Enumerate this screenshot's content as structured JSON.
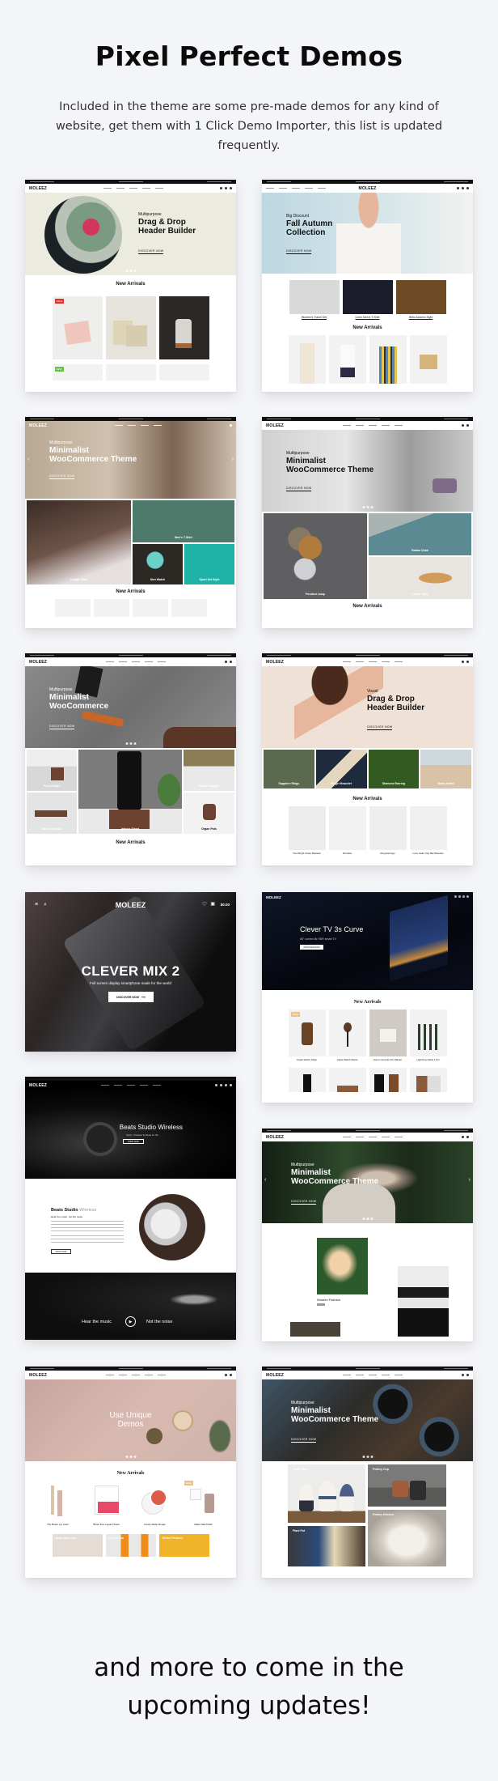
{
  "page": {
    "title": "Pixel Perfect Demos",
    "subtitle": "Included in the theme are some pre-made demos for any kind of website, get them with 1 Click Demo Importer, this list is updated frequently.",
    "footer_line1": "and more to come in the",
    "footer_line2": "upcoming updates!"
  },
  "demos": [
    {
      "brand": "MOLEEZ",
      "eyebrow": "Multipurpose",
      "heading_line1": "Drag & Drop",
      "heading_line2": "Header Builder",
      "button": "DISCOVER NOW",
      "section_title": "New Arrivals",
      "badges": [
        "SALE",
        "NEW"
      ],
      "colors": {
        "hero_bg": "#ecebdf",
        "accent": "#c9283c"
      }
    },
    {
      "brand": "MOLEEZ",
      "eyebrow": "Big Discount",
      "heading_line1": "Fall Autumn",
      "heading_line2": "Collection",
      "button": "DISCOVER NOW",
      "categories": [
        "Women's Travel Set",
        "Linen Men's T-Shirt",
        "Hello Autumn Style"
      ],
      "section_title": "New Arrivals",
      "colors": {
        "hero_bg": "#bcd7e0"
      }
    },
    {
      "brand": "MOLEEZ",
      "eyebrow": "Multipurpose",
      "heading_line1": "Minimalist",
      "heading_line2": "WooCommerce Theme",
      "button": "DISCOVER NOW",
      "categories": [
        "Couple Style",
        "Men's T-Shirt",
        "Men Watch",
        "Sport Set Style"
      ],
      "section_title": "New Arrivals",
      "colors": {
        "hero_bg": "#c9b9a6",
        "teal": "#1fb2a6",
        "green": "#4d7a6b"
      }
    },
    {
      "brand": "MOLEEZ",
      "eyebrow": "Multipurpose",
      "heading_line1": "Minimalist",
      "heading_line2": "WooCommerce Theme",
      "button": "DISCOVER NOW",
      "categories": [
        "Pendant Lamp",
        "Rattan Chair",
        "Coffee Table"
      ],
      "section_title": "New Arrivals",
      "colors": {
        "hero_bg": "#c8c8c8",
        "rug": "#5c8a93"
      }
    },
    {
      "brand": "MOLEEZ",
      "eyebrow": "Multipurpose",
      "heading_line1": "Minimalist",
      "heading_line2": "WooCommerce",
      "button": "DISCOVER NOW",
      "categories": [
        "Pens Holder",
        "Iphone Stand",
        "Watch Charger",
        "iMac Stand Set",
        "Organ Pots"
      ],
      "section_title": "New Arrivals",
      "colors": {
        "hero_bg": "#7c7c7c",
        "leather": "#c8662a",
        "wood": "#6b4330"
      }
    },
    {
      "brand": "MOLEEZ",
      "eyebrow": "Visual",
      "heading_line1": "Drag & Drop",
      "heading_line2": "Header Builder",
      "button": "DISCOVER NOW",
      "categories": [
        "Sapphire Rings",
        "Finger Bracelet",
        "Diamond Earring",
        "Body Anklet"
      ],
      "section_title": "New Arrivals",
      "products": [
        "Two Bright Chain Bracelet",
        "Pendant",
        "Ring Earrings",
        "Love Heart Clip Bar Bracelet"
      ],
      "colors": {
        "hero_bg": "#efe1d6"
      }
    },
    {
      "brand": "MOLEEZ",
      "heading": "CLEVER MIX 2",
      "tagline": "Full screen display smartphone made for the world",
      "button": "DISCOVER NOW",
      "cart_total": "$0.00",
      "colors": {
        "hero_bg": "#0e0c0c"
      }
    },
    {
      "brand": "MOLEEZ",
      "heading": "Clever TV 3s Curve",
      "tagline": "65\" curved 4k HDR smart TV",
      "button": "DISCOVER NOW",
      "section_title": "New Arrivals",
      "products": [
        "Apple Watch Strap",
        "Apple Watch Stand",
        "Home Ceramic Pot Planter",
        "Lightning Cable 1.5m"
      ],
      "badges": [
        "SALE"
      ],
      "colors": {
        "hero_bg": "#0b0f1c",
        "price": "#e8a21d"
      }
    },
    {
      "brand": "MOLEEZ",
      "heading": "Beats Studio Wireless",
      "tagline": "Sport, Creative & Ideas for life",
      "button": "SHOP NOW",
      "feature_title": "Beats Studio",
      "feature_title_light": "Wireless",
      "feature_sub": "Hear the music, not the noise",
      "feature_button": "SHOP NOW",
      "banner_left": "Hear the music",
      "banner_right": "Not the noise",
      "colors": {
        "hero_bg": "#000000"
      }
    },
    {
      "brand": "MOLEEZ",
      "eyebrow": "Multipurpose",
      "heading_line1": "Minimalist",
      "heading_line2": "WooCommerce Theme",
      "button": "DISCOVER NOW",
      "feature_caption": "Women Fashion",
      "feature_button": "SHOP NOW",
      "colors": {
        "hero_bg": "#2a3a28"
      }
    },
    {
      "brand": "MOLEEZ",
      "heading_line1": "Use Unique",
      "heading_line2": "Demos",
      "section_title": "New Arrivals",
      "products": [
        "The Better Lip Color",
        "Blush Duo Liquid Cheek",
        "Candy Matte Rouge",
        "Matte Nail Polish"
      ],
      "badges": [
        "SALE"
      ],
      "categories": [
        "Body Skin Care",
        "Sun Cream",
        "Winter Perfume"
      ],
      "colors": {
        "hero_bg": "#d8b9b0",
        "blush": "#e8496b",
        "orange": "#f08c1a",
        "yellow": "#f0b32a"
      }
    },
    {
      "brand": "MOLEEZ",
      "eyebrow": "Multipurpose",
      "heading_line1": "Minimalist",
      "heading_line2": "WooCommerce Theme",
      "button": "DISCOVER NOW",
      "categories": [
        "Jewel Vase",
        "Pottery Cup",
        "Pottery Kitchen",
        "Plant Pot"
      ],
      "colors": {
        "hero_bg": "#3a3f44"
      }
    }
  ]
}
